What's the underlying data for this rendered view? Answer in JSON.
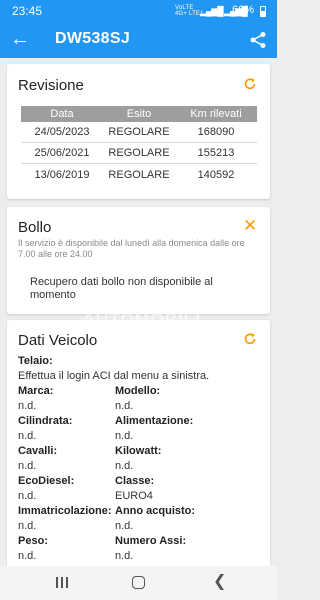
{
  "status_bar": {
    "time": "23:45",
    "network_label": "VoLTE 4G+ LTE1",
    "signal": "▂▄▆█ ▂▄▆█",
    "battery": "60%"
  },
  "app_bar": {
    "back_icon": "arrow-back-icon",
    "title": "DW538SJ",
    "share_icon": "share-icon",
    "color": "#2196f3"
  },
  "revisione": {
    "title": "Revisione",
    "refresh_icon": "refresh-icon",
    "columns": [
      "Data",
      "Esito",
      "Km rilevati"
    ],
    "rows": [
      [
        "24/05/2023",
        "REGOLARE",
        "168090"
      ],
      [
        "25/06/2021",
        "REGOLARE",
        "155213"
      ],
      [
        "13/06/2019",
        "REGOLARE",
        "140592"
      ]
    ]
  },
  "bollo": {
    "title": "Bollo",
    "close_icon": "close-icon",
    "note": "Il servizio è disponibile dal lunedì alla domenica dalle ore 7.00 alle ore 24.00",
    "message": "Recupero dati bollo non disponibile al momento"
  },
  "watermark": {
    "line1": "SUBITO",
    "line2": "AUTOMOBILI"
  },
  "dati_veicolo": {
    "title": "Dati Veicolo",
    "refresh_icon": "refresh-icon",
    "telaio_label": "Telaio:",
    "telaio_value": "Effettua il login ACI dal menu a sinistra.",
    "fields": [
      {
        "label": "Marca:",
        "value": "n.d."
      },
      {
        "label": "Modello:",
        "value": "n.d."
      },
      {
        "label": "Cilindrata:",
        "value": "n.d."
      },
      {
        "label": "Alimentazione:",
        "value": "n.d."
      },
      {
        "label": "Cavalli:",
        "value": "n.d."
      },
      {
        "label": "Kilowatt:",
        "value": "n.d."
      },
      {
        "label": "EcoDiesel:",
        "value": "n.d."
      },
      {
        "label": "Classe:",
        "value": "EURO4"
      },
      {
        "label": "Immatricolazione:",
        "value": "n.d."
      },
      {
        "label": "Anno acquisto:",
        "value": "n.d."
      },
      {
        "label": "Peso:",
        "value": "n.d."
      },
      {
        "label": "Numero Assi:",
        "value": "n.d."
      }
    ]
  },
  "accent_color": "#ff9800",
  "nav_bar": {
    "recents_icon": "recents-icon",
    "home_icon": "home-icon",
    "back_icon": "back-icon"
  }
}
